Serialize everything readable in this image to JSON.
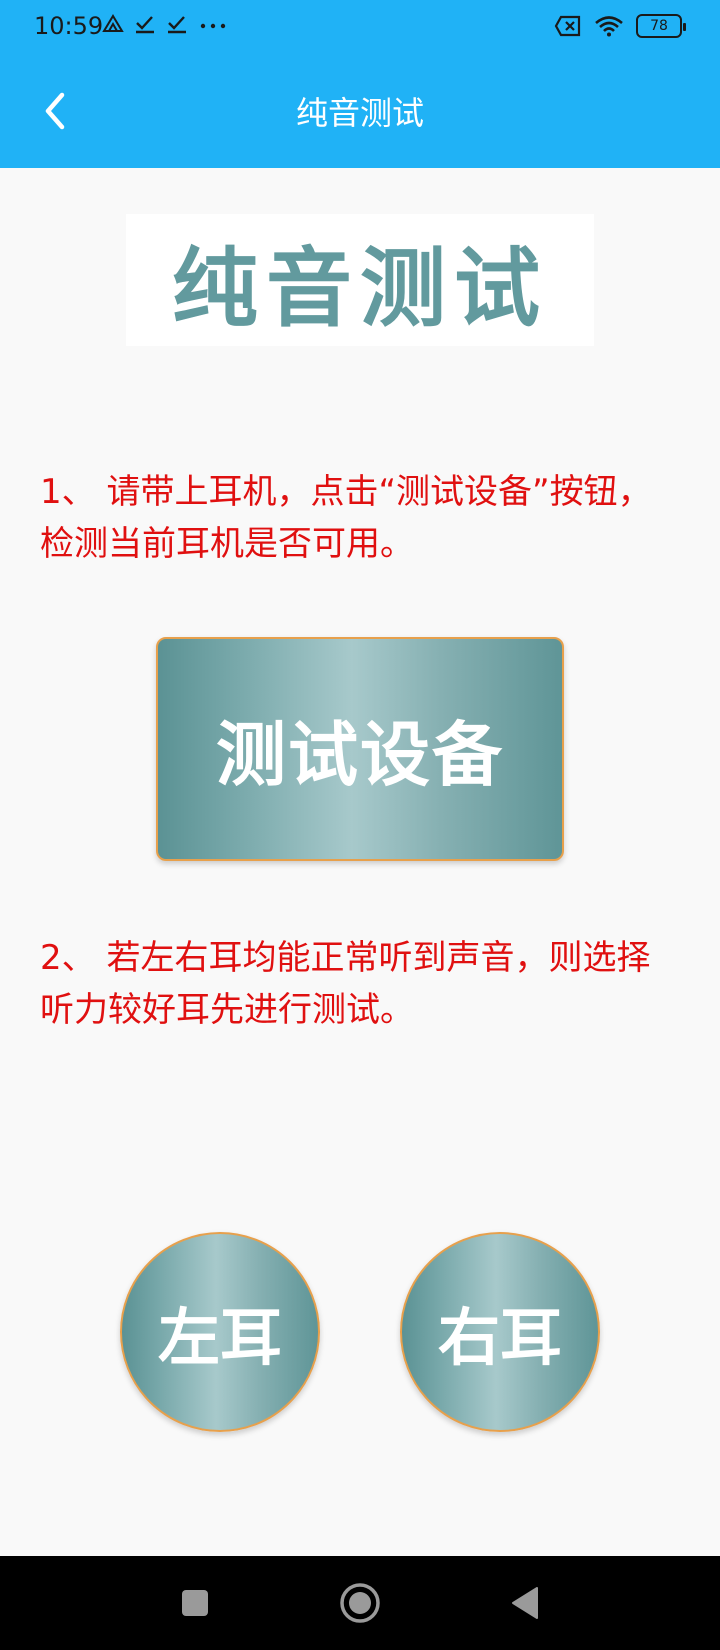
{
  "status_bar": {
    "time": "10:59",
    "battery": "78"
  },
  "app_bar": {
    "title": "纯音测试"
  },
  "logo": {
    "text": "纯音测试"
  },
  "instructions": {
    "step1": "1、 请带上耳机，点击“测试设备”按钮，检测当前耳机是否可用。",
    "step2": "2、 若左右耳均能正常听到声音，则选择听力较好耳先进行测试。"
  },
  "buttons": {
    "test_device": "测试设备",
    "left_ear": "左耳",
    "right_ear": "右耳"
  },
  "colors": {
    "app_bar": "#20b2f6",
    "instruction_text": "#e01010",
    "button_border": "#e7a04c",
    "logo_text": "#629a9e"
  }
}
